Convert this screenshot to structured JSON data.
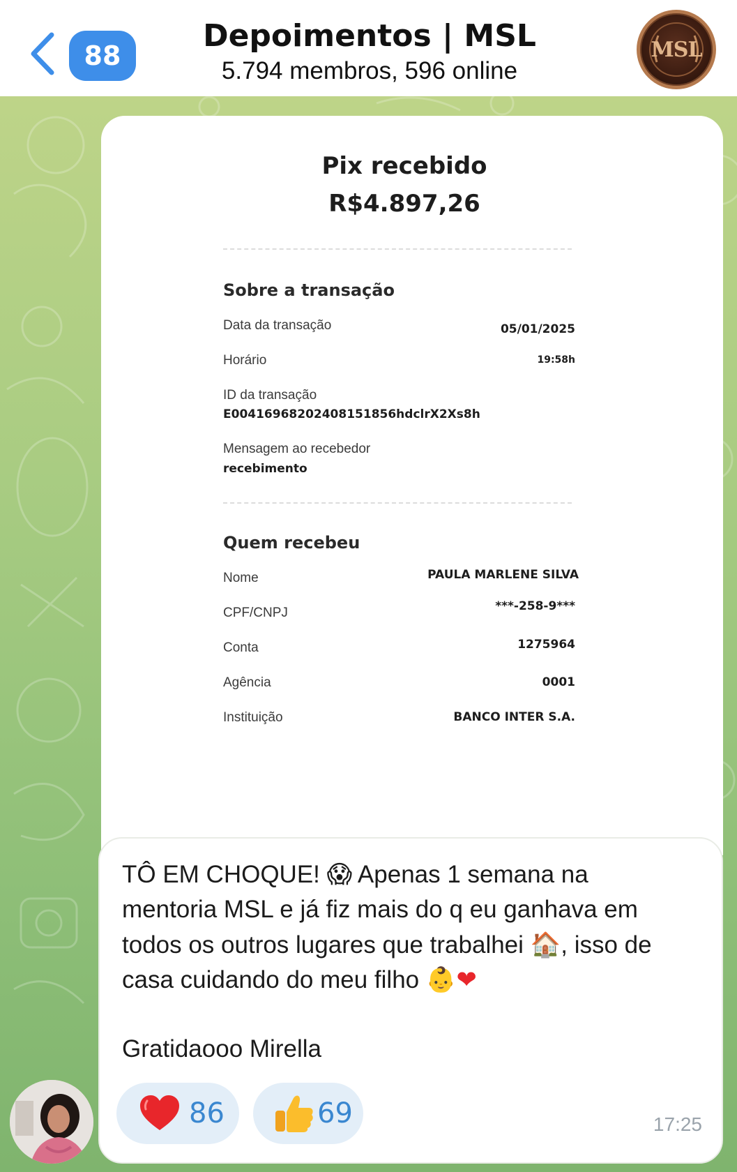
{
  "header": {
    "unread_count": "88",
    "title": "Depoimentos | MSL",
    "subtitle": "5.794 membros, 596 online",
    "avatar_text": "MSL"
  },
  "receipt": {
    "title": "Pix recebido",
    "amount": "R$4.897,26",
    "transaction_section": {
      "heading": "Sobre a transação",
      "date_label": "Data da transação",
      "date_value": "05/01/2025",
      "time_label": "Horário",
      "time_value": "19:58h",
      "id_label": "ID da transação",
      "id_value": "E00416968202408151856hdclrX2Xs8h",
      "message_label": "Mensagem ao recebedor",
      "message_value": "recebimento"
    },
    "recipient_section": {
      "heading": "Quem recebeu",
      "rows": [
        {
          "label": "Nome",
          "value": "PAULA MARLENE SILVA"
        },
        {
          "label": "CPF/CNPJ",
          "value": "***-258-9***"
        },
        {
          "label": "Conta",
          "value": "1275964"
        },
        {
          "label": "Agência",
          "value": "0001"
        },
        {
          "label": "Instituição",
          "value": "BANCO INTER S.A."
        }
      ]
    }
  },
  "message": {
    "line1_a": "TÔ EM CHOQUE! ",
    "line1_emoji": "😱",
    "line1_b": " Apenas 1 semana na",
    "line2": "mentoria MSL e já fiz mais do q eu ganhava em",
    "line3_a": "todos os outros lugares que trabalhei ",
    "line3_emoji": "🏠",
    "line3_b": ", isso de",
    "line4_a": "casa cuidando do meu filho ",
    "line4_emoji": "👶",
    "line4_heart": "❤",
    "line5": "Gratidaooo Mirella",
    "timestamp": "17:25"
  },
  "reactions": [
    {
      "emoji": "❤",
      "count": "86",
      "icon": "heart-icon"
    },
    {
      "emoji": "👍",
      "count": "69",
      "icon": "thumbs-up-icon"
    }
  ],
  "colors": {
    "accent": "#3e8ee9",
    "reaction_bg": "#e3eef8",
    "reaction_text": "#3a87d0",
    "heart": "#e8262b",
    "wallpaper_top": "#c3d68a",
    "wallpaper_bottom": "#7fb46e"
  }
}
